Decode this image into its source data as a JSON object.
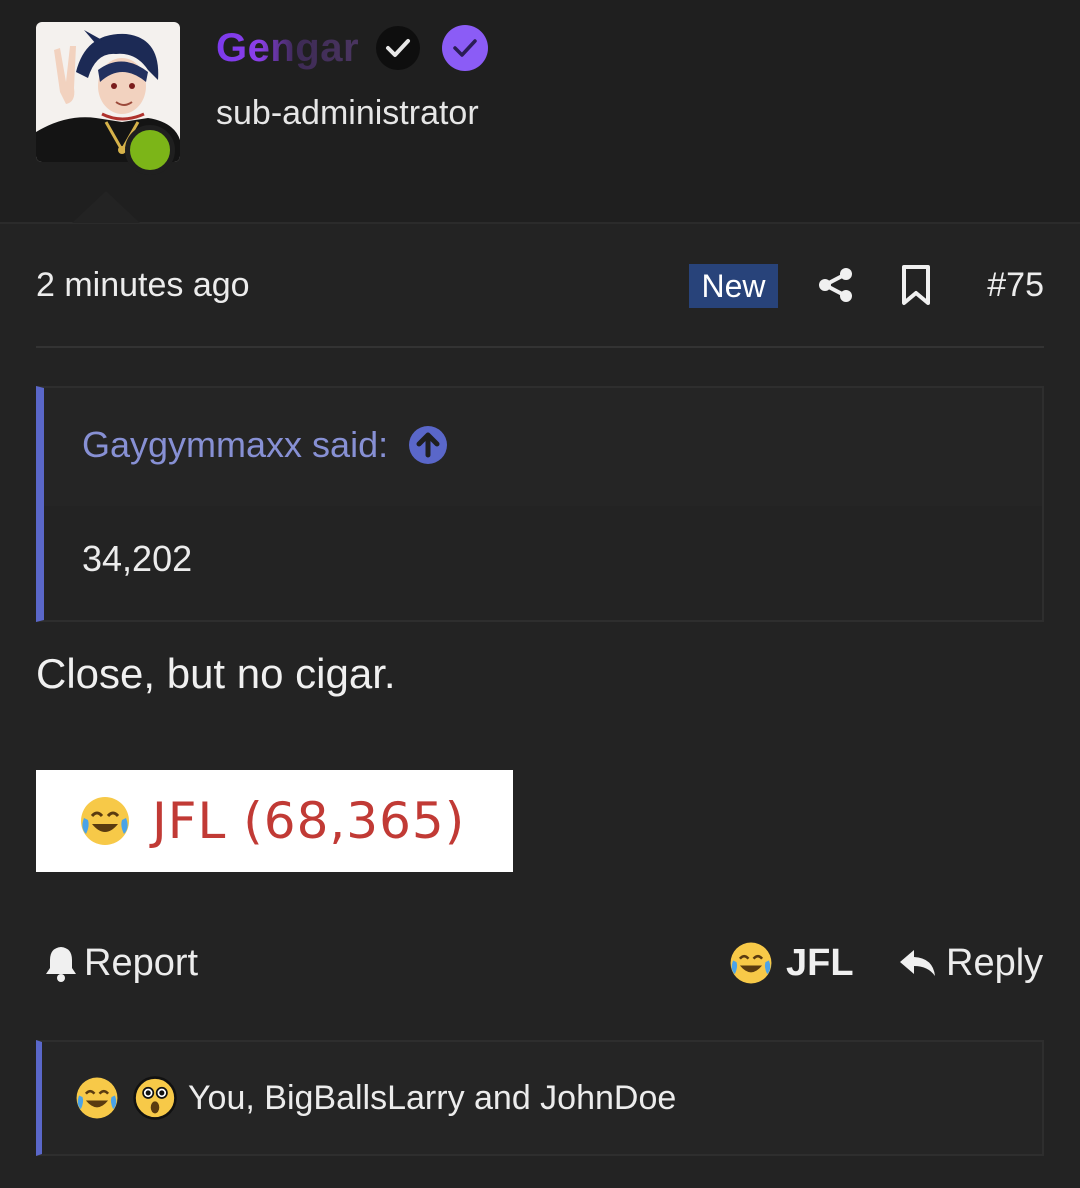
{
  "header": {
    "username": "Gengar",
    "user_title": "sub-administrator",
    "online_status": "online",
    "colors": {
      "username_gradient_start": "#7c3aed",
      "online": "#7cb518",
      "verified_badge": "#8b5cf6"
    }
  },
  "post": {
    "timestamp": "2 minutes ago",
    "new_label": "New",
    "post_number": "#75",
    "quote": {
      "author_label": "Gaygymmaxx said:",
      "text": "34,202"
    },
    "message": "Close, but no cigar.",
    "embedded_image": {
      "emoji": "joy-emoji",
      "text": "JFL (68,365)"
    }
  },
  "actions": {
    "report_label": "Report",
    "reaction_label": "JFL",
    "reply_label": "Reply"
  },
  "reactions_summary": {
    "icons": [
      "joy-emoji",
      "astonished-emoji"
    ],
    "text": "You, BigBallsLarry and JohnDoe"
  },
  "accent_colors": {
    "new_badge": "#28437a",
    "quote_bar": "#5a67c9",
    "quote_author": "#8790d4",
    "image_text": "#c13a35"
  }
}
